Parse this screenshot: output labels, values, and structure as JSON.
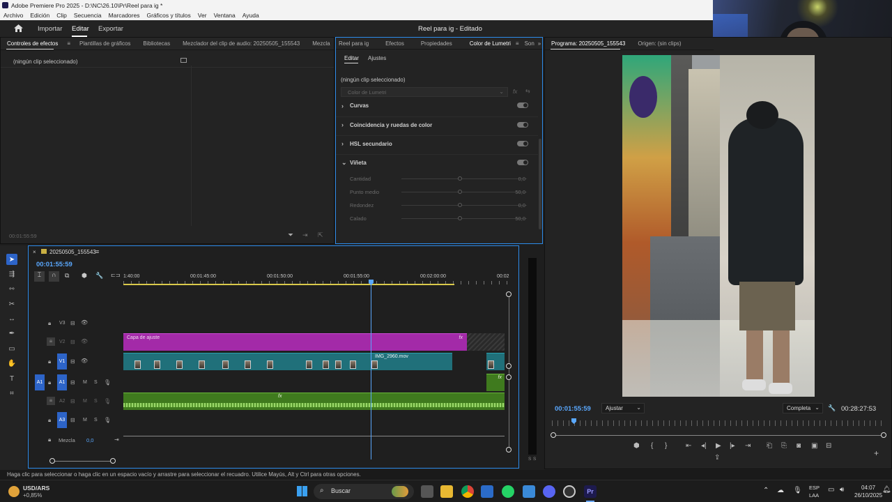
{
  "window": {
    "title": "Adobe Premiere Pro 2025 - D:\\NC\\26.10\\Pr\\Reel para ig *"
  },
  "menu": [
    "Archivo",
    "Edición",
    "Clip",
    "Secuencia",
    "Marcadores",
    "Gráficos y títulos",
    "Ver",
    "Ventana",
    "Ayuda"
  ],
  "header": {
    "import": "Importar",
    "edit": "Editar",
    "export": "Exportar",
    "project_title": "Reel para ig - Editado"
  },
  "left_panel": {
    "tabs": [
      "Controles de efectos",
      "Plantillas de gráficos",
      "Bibliotecas",
      "Mezclador del clip de audio: 20250505_155543",
      "Mezcla"
    ],
    "no_clip": "(ningún clip seleccionado)",
    "timecode": "00:01:55:59"
  },
  "lumetri": {
    "tabs": [
      "Reel para ig",
      "Efectos",
      "Propiedades",
      "Color de Lumetri",
      "Son"
    ],
    "subtabs": [
      "Editar",
      "Ajustes"
    ],
    "no_clip": "(ningún clip seleccionado)",
    "dropdown": "Color de Lumetri",
    "sections": [
      "Curvas",
      "Coincidencia y ruedas de color",
      "HSL secundario",
      "Viñeta"
    ],
    "sliders": [
      {
        "label": "Cantidad",
        "value": "0,0"
      },
      {
        "label": "Punto medio",
        "value": "50,0"
      },
      {
        "label": "Redondez",
        "value": "0,0"
      },
      {
        "label": "Calado",
        "value": "50,0"
      }
    ]
  },
  "program": {
    "tabs": [
      "Programa: 20250505_155543",
      "Origen: (sin clips)"
    ],
    "timecode": "00:01:55:59",
    "fit": "Ajustar",
    "quality": "Completa",
    "duration": "00:28:27:53"
  },
  "timeline": {
    "sequence_name": "20250505_155543",
    "timecode": "00:01:55:59",
    "ruler": [
      "1:40:00",
      "00:01:45:00",
      "00:01:50:00",
      "00:01:55:00",
      "00:02:00:00",
      "00:02"
    ],
    "tracks": [
      {
        "name": "V3",
        "type": "video"
      },
      {
        "name": "V2",
        "type": "video"
      },
      {
        "name": "V1",
        "type": "video",
        "src": "V1"
      },
      {
        "name": "A1",
        "type": "audio",
        "src": "A1",
        "m": "M",
        "s": "S"
      },
      {
        "name": "A2",
        "type": "audio",
        "m": "M",
        "s": "S"
      },
      {
        "name": "A3",
        "type": "audio",
        "m": "M",
        "s": "S"
      }
    ],
    "mix_label": "Mezcla",
    "mix_value": "0,0",
    "adjustment_clip": "Capa de ajuste",
    "clip_label": "IMG_2960.mov",
    "fx": "fx",
    "meter_labels": [
      "S",
      "S"
    ]
  },
  "status": "Haga clic para seleccionar o haga clic en un espacio vacío y arrastre para seleccionar el recuadro. Utilice Mayús, Alt y Ctrl para otras opciones.",
  "taskbar": {
    "ticker": "USD/ARS",
    "ticker_change": "+0,85%",
    "search": "Buscar",
    "lang1": "ESP",
    "lang2": "LAA",
    "time": "04:07",
    "date": "26/10/2025"
  },
  "colors": {
    "accent": "#2d8ceb",
    "video_clip": "#20707a",
    "adjust_clip": "#a32aa8",
    "audio_clip": "#3f7a1e"
  }
}
